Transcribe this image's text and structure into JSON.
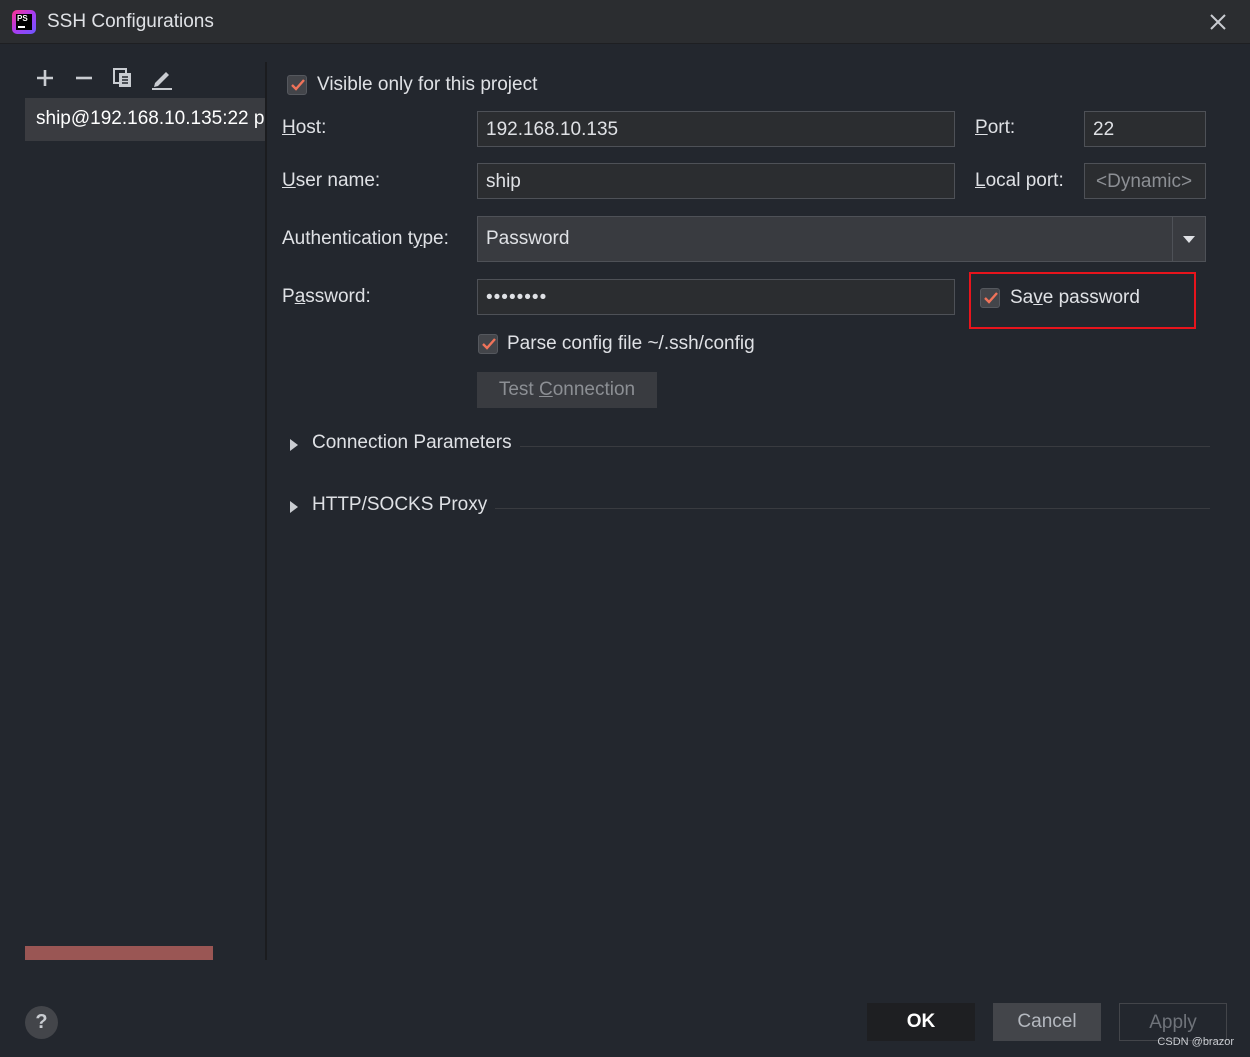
{
  "window": {
    "title": "SSH Configurations",
    "app_logo_text": "PS"
  },
  "sidebar": {
    "items": [
      {
        "label": "ship@192.168.10.135:22 p"
      }
    ]
  },
  "form": {
    "visible_only": {
      "label": "Visible only for this project",
      "checked": true
    },
    "host": {
      "label_mnemonic": "H",
      "label_rest": "ost:",
      "value": "192.168.10.135"
    },
    "port": {
      "label_mnemonic": "P",
      "label_rest": "ort:",
      "value": "22"
    },
    "user_name": {
      "label_mnemonic": "U",
      "label_rest": "ser name:",
      "value": "ship"
    },
    "local_port": {
      "label_mnemonic": "L",
      "label_rest": "ocal port:",
      "placeholder": "<Dynamic>"
    },
    "auth_type": {
      "label_pre": "Authentication t",
      "label_mnemonic": "y",
      "label_post": "pe:",
      "value": "Password"
    },
    "password": {
      "label_pre": "P",
      "label_mnemonic": "a",
      "label_post": "ssword:",
      "value": "••••••••"
    },
    "save_password": {
      "label_pre": "Sa",
      "label_mnemonic": "v",
      "label_post": "e password",
      "checked": true
    },
    "parse_config": {
      "label": "Parse config file ~/.ssh/config",
      "checked": true
    },
    "test_connection": {
      "label_pre": "Test ",
      "label_mnemonic": "C",
      "label_post": "onnection"
    }
  },
  "sections": [
    {
      "title": "Connection Parameters",
      "expanded": false
    },
    {
      "title": "HTTP/SOCKS Proxy",
      "expanded": false
    }
  ],
  "footer": {
    "help": "?",
    "ok": "OK",
    "cancel": "Cancel",
    "apply": "Apply"
  },
  "watermark": "CSDN @brazor",
  "colors": {
    "checkbox_mark": "#f0735a",
    "highlight": "#e8141c",
    "scroll_mark": "#9a5654"
  }
}
